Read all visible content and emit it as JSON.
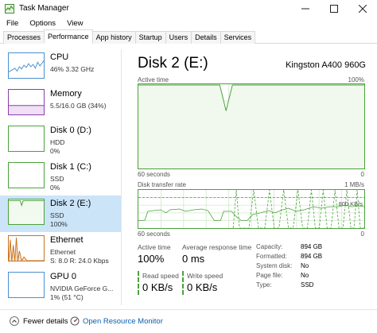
{
  "window": {
    "title": "Task Manager"
  },
  "menu": [
    "File",
    "Options",
    "View"
  ],
  "tabs": [
    "Processes",
    "Performance",
    "App history",
    "Startup",
    "Users",
    "Details",
    "Services"
  ],
  "sidebar": {
    "items": [
      {
        "name": "CPU",
        "line1": "46% 3.32 GHz",
        "line2": ""
      },
      {
        "name": "Memory",
        "line1": "5.5/16.0 GB (34%)",
        "line2": ""
      },
      {
        "name": "Disk 0 (D:)",
        "line1": "HDD",
        "line2": "0%"
      },
      {
        "name": "Disk 1 (C:)",
        "line1": "SSD",
        "line2": "0%"
      },
      {
        "name": "Disk 2 (E:)",
        "line1": "SSD",
        "line2": "100%"
      },
      {
        "name": "Ethernet",
        "line1": "Ethernet",
        "line2": "S: 8.0 R: 24.0 Kbps"
      },
      {
        "name": "GPU 0",
        "line1": "NVIDIA GeForce G...",
        "line2": "1% (51 °C)"
      }
    ]
  },
  "main": {
    "title": "Disk 2 (E:)",
    "model": "Kingston A400 960G",
    "active_chart": {
      "label": "Active time",
      "max_label": "100%",
      "time_label": "60 seconds",
      "min_label": "0"
    },
    "transfer_chart": {
      "label": "Disk transfer rate",
      "max_label": "1 MB/s",
      "mid_label": "800 KB/s",
      "time_label": "60 seconds",
      "min_label": "0"
    },
    "stats": {
      "active_time_label": "Active time",
      "active_time_value": "100%",
      "response_label": "Average response time",
      "response_value": "0 ms",
      "read_label": "Read speed",
      "read_value": "0 KB/s",
      "write_label": "Write speed",
      "write_value": "0 KB/s"
    },
    "properties": [
      {
        "key": "Capacity:",
        "value": "894 GB"
      },
      {
        "key": "Formatted:",
        "value": "894 GB"
      },
      {
        "key": "System disk:",
        "value": "No"
      },
      {
        "key": "Page file:",
        "value": "No"
      },
      {
        "key": "Type:",
        "value": "SSD"
      }
    ]
  },
  "footer": {
    "fewer_details": "Fewer details",
    "resource_monitor": "Open Resource Monitor"
  },
  "colors": {
    "disk_green": "#4aa23b",
    "cpu_blue": "#4a8fd1",
    "memory_purple": "#8b3fa8",
    "ethernet_orange": "#c8731f",
    "selected_bg": "#cce4f7",
    "link_blue": "#0a5fb0"
  }
}
